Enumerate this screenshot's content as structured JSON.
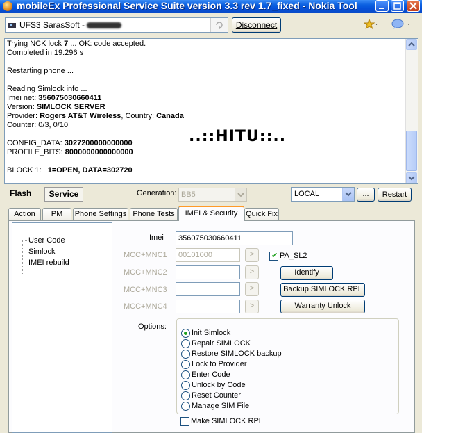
{
  "window": {
    "title": "mobileEx Professional Service Suite version 3.3 rev 1.7_fixed  - Nokia Tool"
  },
  "toolbar": {
    "device_label": "UFS3 SarasSoft -",
    "disconnect_label": "Disconnect"
  },
  "log": {
    "lines": [
      {
        "prefix": "Trying NCK lock ",
        "bold": "7",
        "suffix": " ... OK: code accepted."
      },
      {
        "prefix": "Completed in 19.296 s",
        "bold": "",
        "suffix": ""
      },
      {
        "prefix": "",
        "bold": "",
        "suffix": ""
      },
      {
        "prefix": "Restarting phone ...",
        "bold": "",
        "suffix": ""
      },
      {
        "prefix": "",
        "bold": "",
        "suffix": ""
      },
      {
        "prefix": "Reading Simlock info ...",
        "bold": "",
        "suffix": ""
      },
      {
        "prefix": "Imei net: ",
        "bold": "356075030660411",
        "suffix": ""
      },
      {
        "prefix": "Version: ",
        "bold": "SIMLOCK SERVER",
        "suffix": ""
      },
      {
        "prefix": "Provider: ",
        "bold": "Rogers AT&T Wireless",
        "suffix": ", Country: ",
        "bold2": "Canada"
      },
      {
        "prefix": "Counter: 0/3, 0/10",
        "bold": "",
        "suffix": ""
      },
      {
        "prefix": "",
        "bold": "",
        "suffix": ""
      },
      {
        "prefix": "CONFIG_DATA: ",
        "bold": "3027200000000000",
        "suffix": ""
      },
      {
        "prefix": "PROFILE_BITS: ",
        "bold": "8000000000000000",
        "suffix": ""
      },
      {
        "prefix": "",
        "bold": "",
        "suffix": ""
      },
      {
        "prefix": "BLOCK 1:   ",
        "bold": "1=OPEN, DATA=302720",
        "suffix": ""
      }
    ],
    "watermark": "..::HITU::.."
  },
  "modes": {
    "flash": "Flash",
    "service": "Service",
    "generation_label": "Generation:",
    "generation_value": "BB5",
    "connection_value": "LOCAL",
    "dots_label": "...",
    "restart_label": "Restart"
  },
  "tabs": [
    {
      "label": "Action"
    },
    {
      "label": "PM"
    },
    {
      "label": "Phone Settings"
    },
    {
      "label": "Phone Tests"
    },
    {
      "label": "IMEI & Security"
    },
    {
      "label": "Quick Fix"
    }
  ],
  "active_tab": "IMEI & Security",
  "tree": {
    "items": [
      "User Code",
      "Simlock",
      "IMEI rebuild"
    ]
  },
  "form": {
    "imei_label": "Imei",
    "imei_value": "356075030660411",
    "mcc1_label": "MCC+MNC1",
    "mcc1_value": "00101000",
    "mcc2_label": "MCC+MNC2",
    "mcc3_label": "MCC+MNC3",
    "mcc4_label": "MCC+MNC4",
    "arrow_glyph": ">",
    "pa_sl2_label": "PA_SL2",
    "pa_sl2_checked": true,
    "identify_label": "Identify",
    "backup_label": "Backup SIMLOCK RPL",
    "warranty_label": "Warranty Unlock",
    "options_label": "Options:",
    "options": [
      "Init Simlock",
      "Repair SIMLOCK",
      "Restore SIMLOCK backup",
      "Lock to Provider",
      "Enter Code",
      "Unlock by Code",
      "Reset Counter",
      "Manage SIM File"
    ],
    "selected_option": "Init Simlock",
    "make_rpl_label": "Make SIMLOCK RPL",
    "make_rpl_checked": false
  },
  "colors": {
    "titlebar": "#0a5fe0",
    "window_bg": "#ece9d8",
    "tab_highlight": "#ff9a28",
    "check_green": "#21a121"
  }
}
